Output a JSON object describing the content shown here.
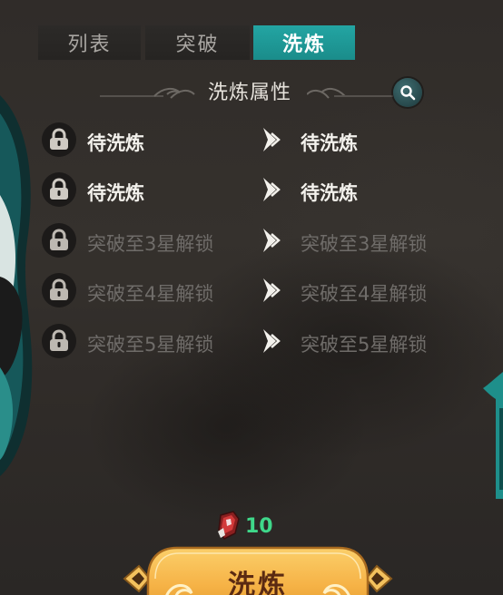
{
  "tabs": {
    "list_label": "列表",
    "breakthrough_label": "突破",
    "refine_label": "洗炼",
    "active": "refine"
  },
  "section": {
    "title": "洗炼属性"
  },
  "attributes": [
    {
      "current": "待洗炼",
      "next": "待洗炼",
      "locked": false
    },
    {
      "current": "待洗炼",
      "next": "待洗炼",
      "locked": false
    },
    {
      "current": "突破至3星解锁",
      "next": "突破至3星解锁",
      "locked": true
    },
    {
      "current": "突破至4星解锁",
      "next": "突破至4星解锁",
      "locked": true
    },
    {
      "current": "突破至5星解锁",
      "next": "突破至5星解锁",
      "locked": true
    }
  ],
  "cost": {
    "icon": "refine-stone-icon",
    "value": "10"
  },
  "action": {
    "refine_button_label": "洗炼"
  },
  "colors": {
    "accent_teal": "#1fa3a1",
    "active_text": "#f3f1ec",
    "locked_text": "#6f6c69",
    "cost_green": "#3fd88a",
    "button_gold": "#f6b347"
  }
}
